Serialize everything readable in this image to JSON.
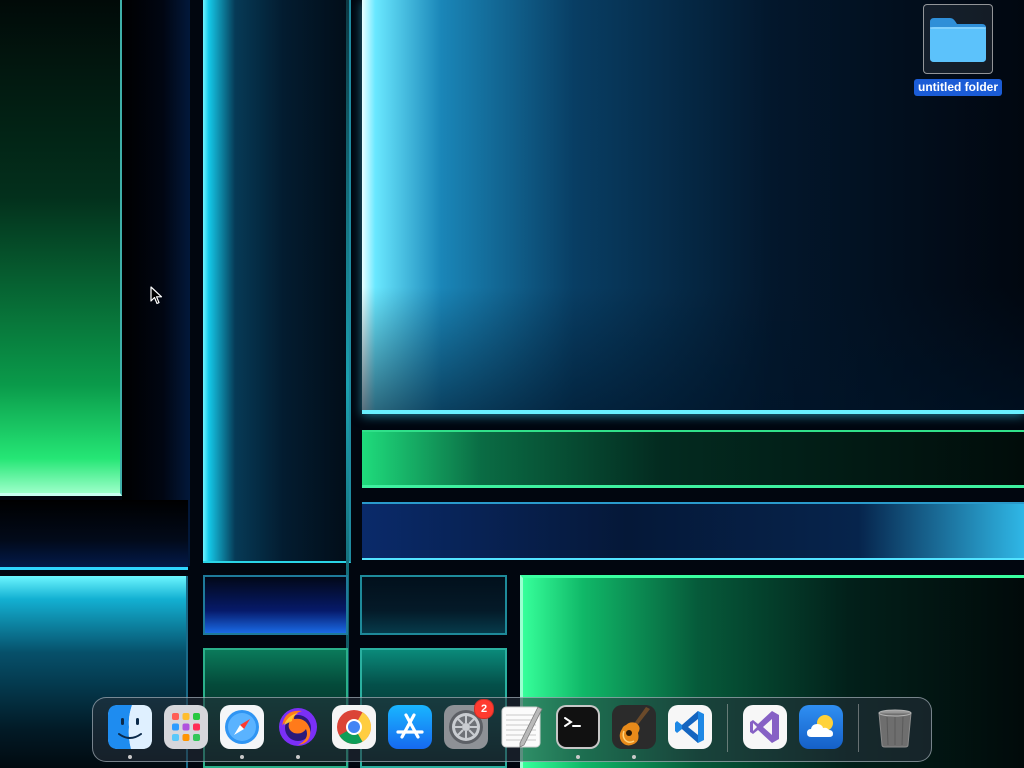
{
  "desktop": {
    "folder": {
      "label": "untitled folder",
      "icon": "folder-icon",
      "color": "#4cb4f5"
    }
  },
  "dock": {
    "apps": [
      {
        "name": "Finder",
        "icon": "finder-icon",
        "running": true
      },
      {
        "name": "Launchpad",
        "icon": "launchpad-icon",
        "running": false
      },
      {
        "name": "Safari",
        "icon": "safari-icon",
        "running": true
      },
      {
        "name": "Firefox",
        "icon": "firefox-icon",
        "running": true
      },
      {
        "name": "Google Chrome",
        "icon": "chrome-icon",
        "running": false
      },
      {
        "name": "App Store",
        "icon": "app-store-icon",
        "running": false
      },
      {
        "name": "System Preferences",
        "icon": "system-preferences-icon",
        "running": false,
        "badge": "2"
      },
      {
        "name": "TextEdit",
        "icon": "textedit-icon",
        "running": false
      },
      {
        "name": "Terminal",
        "icon": "terminal-icon",
        "running": true
      },
      {
        "name": "GarageBand",
        "icon": "garageband-icon",
        "running": true
      },
      {
        "name": "Visual Studio Code",
        "icon": "vscode-icon",
        "running": false
      }
    ],
    "recent_apps": [
      {
        "name": "Visual Studio",
        "icon": "visual-studio-icon",
        "running": false
      },
      {
        "name": "Weather",
        "icon": "weather-icon",
        "running": false
      }
    ],
    "trash": {
      "name": "Trash",
      "icon": "trash-icon"
    },
    "badge_color": "#ff3b30"
  },
  "colors": {
    "accent_cyan": "#69f0ff",
    "accent_green": "#3affa0",
    "selection_blue": "#1b5cd6"
  }
}
